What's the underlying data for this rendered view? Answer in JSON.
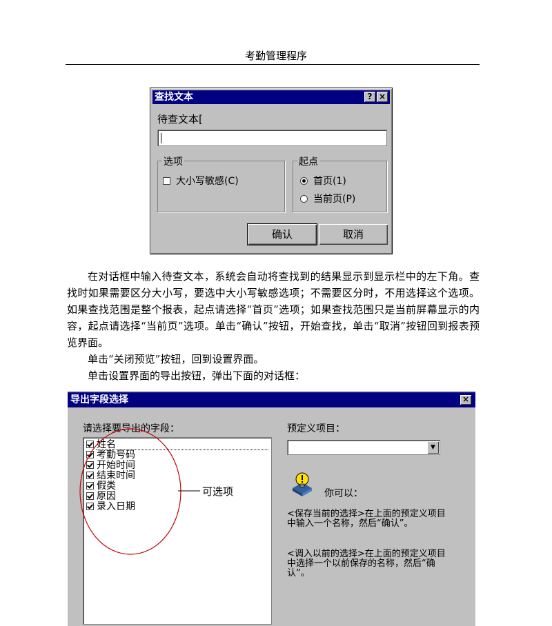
{
  "page": {
    "header": "考勤管理程序"
  },
  "find_dialog": {
    "title": "查找文本",
    "help": "?",
    "close": "×",
    "search_label": "待查文本[",
    "search_value": "",
    "options_group": "选项",
    "case_sensitive": "大小写敏感(C)",
    "start_group": "起点",
    "first_page": "首页(1)",
    "current_page": "当前页(P)",
    "ok": "确认",
    "cancel": "取消"
  },
  "body": {
    "para1": "在对话框中输入待查文本，系统会自动将查找到的结果显示到显示栏中的左下角。查找时如果需要区分大小写，要选中大小写敏感选项；不需要区分时，不用选择这个选项。如果查找范围是整个报表，起点请选择“首页”选项；如果查找范围只是当前屏幕显示的内容，起点请选择“当前页”选项。单击“确认”按钮，开始查找，单击“取消”按钮回到报表预览界面。",
    "para2": "单击“关闭预览”按钮，回到设置界面。",
    "para3": "单击设置界面的导出按钮，弹出下面的对话框："
  },
  "export_dialog": {
    "title": "导出字段选择",
    "close": "×",
    "fields_label": "请选择要导出的字段：",
    "fields": [
      "姓名",
      "考勤号码",
      "开始时间",
      "结束时间",
      "假类",
      "原因",
      "录入日期"
    ],
    "predefined_label": "预定义项目：",
    "predefined_value": "",
    "dropdown_arrow": "▼",
    "hint_heading": "你可以：",
    "hint1": "<保存当前的选择>在上面的预定义项目中输入一个名称，然后“确认”。",
    "hint2": "<调入以前的选择>在上面的预定义项目中选择一个以前保存的名称，然后“确认”。"
  },
  "annotation": {
    "label": "可选项",
    "color": "#c00000"
  }
}
